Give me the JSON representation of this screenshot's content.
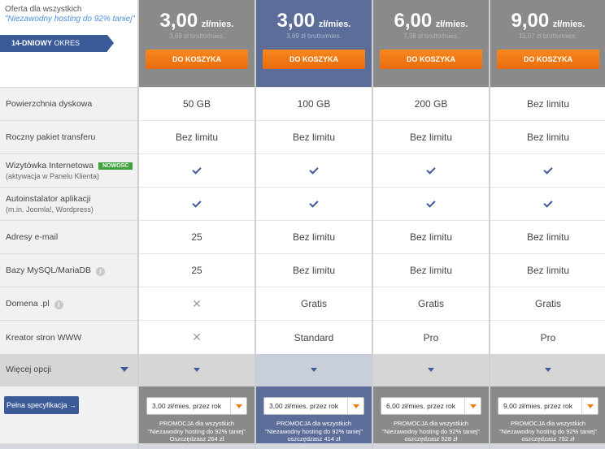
{
  "offer": {
    "title": "Oferta dla wszystkich",
    "subtitle": "\"Niezawodny hosting do 92% taniej\"",
    "trial_bold": "14-DNIOWY",
    "trial_rest": " OKRES PRÓBNY"
  },
  "rows": [
    {
      "label": "Powierzchnia dyskowa",
      "sub": ""
    },
    {
      "label": "Roczny pakiet transferu",
      "sub": ""
    },
    {
      "label": "Wizytówka Internetowa",
      "sub": "(aktywacja w Panelu Klienta)",
      "badge": "NOWOŚĆ"
    },
    {
      "label": "Autoinstalator aplikacji",
      "sub": "(m.in. Joomla!, Wordpress)"
    },
    {
      "label": "Adresy e-mail",
      "sub": ""
    },
    {
      "label": "Bazy MySQL/MariaDB",
      "sub": ""
    },
    {
      "label": "Domena .pl",
      "sub": ""
    },
    {
      "label": "Kreator stron WWW",
      "sub": ""
    }
  ],
  "more_options": "Więcej opcji",
  "spec_button": "Pełna specyfikacja →",
  "cart_label": "DO KOSZYKA",
  "plans": [
    {
      "price": "3,00",
      "unit": "zł/mies.",
      "brutto": "3,69 zł brutto/mies.",
      "values": [
        "50 GB",
        "Bez limitu",
        "check",
        "check",
        "25",
        "25",
        "cross",
        "cross"
      ],
      "select": "3,00 zł/mies. przez rok",
      "promo1": "PROMOCJA dla wszystkich",
      "promo2": "\"Niezawodny hosting do 92% taniej\"",
      "promo3": "Oszczędzasz 264 zł"
    },
    {
      "price": "3,00",
      "unit": "zł/mies.",
      "brutto": "3,69 zł brutto/mies.",
      "values": [
        "100 GB",
        "Bez limitu",
        "check",
        "check",
        "Bez limitu",
        "Bez limitu",
        "Gratis",
        "Standard"
      ],
      "select": "3,00 zł/mies. przez rok",
      "promo1": "PROMOCJA dla wszystkich",
      "promo2": "\"Niezawodny hosting do 92% taniej\"",
      "promo3": "oszczędzasz 414 zł"
    },
    {
      "price": "6,00",
      "unit": "zł/mies.",
      "brutto": "7,38 zł brutto/mies.",
      "values": [
        "200 GB",
        "Bez limitu",
        "check",
        "check",
        "Bez limitu",
        "Bez limitu",
        "Gratis",
        "Pro"
      ],
      "select": "6,00 zł/mies. przez rok",
      "promo1": "PROMOCJA dla wszystkich",
      "promo2": "\"Niezawodny hosting do 92% taniej\"",
      "promo3": "oszczędzasz 528 zł"
    },
    {
      "price": "9,00",
      "unit": "zł/mies.",
      "brutto": "11,07 zł brutto/mies.",
      "values": [
        "Bez limitu",
        "Bez limitu",
        "check",
        "check",
        "Bez limitu",
        "Bez limitu",
        "Gratis",
        "Pro"
      ],
      "select": "9,00 zł/mies. przez rok",
      "promo1": "PROMOCJA dla wszystkich",
      "promo2": "\"Niezawodny hosting do 92% taniej\"",
      "promo3": "oszczędzasz 792 zł"
    }
  ],
  "icons": {
    "check": "check-icon",
    "cross": "cross-icon",
    "info": "info-icon",
    "chevron": "chevron-down-icon"
  },
  "colors": {
    "accent": "#3b5a98",
    "cart": "#f07c17",
    "header_gray": "#8a8a8a",
    "header_featured": "#5b6d98",
    "badge_new": "#3ca23c"
  }
}
